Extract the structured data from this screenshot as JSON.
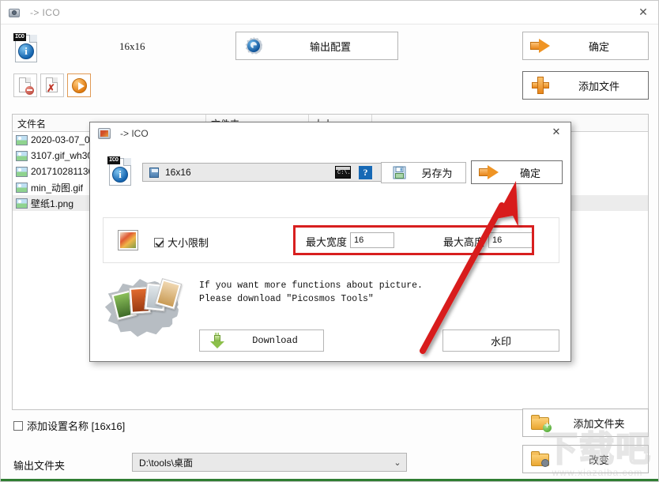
{
  "main_window": {
    "title": "-> ICO",
    "icon": "camera-icon",
    "close_label": "✕",
    "size_label": "16x16",
    "buttons": {
      "output_config": "输出配置",
      "confirm": "确定",
      "add_file": "添加文件",
      "add_folder": "添加文件夹",
      "change": "改变"
    },
    "toolbar": [
      {
        "name": "remove-file-button",
        "tooltip_icon": "document-minus-icon"
      },
      {
        "name": "clear-list-button",
        "tooltip_icon": "document-delete-icon"
      },
      {
        "name": "start-button",
        "tooltip_icon": "play-icon"
      }
    ],
    "file_list": {
      "columns": [
        "文件名",
        "文件夹",
        "大小",
        ""
      ],
      "rows": [
        {
          "name": "2020-03-07_0",
          "selected": false
        },
        {
          "name": "3107.gif_wh30",
          "selected": false
        },
        {
          "name": "201710281130",
          "selected": false
        },
        {
          "name": "min_动图.gif",
          "selected": false
        },
        {
          "name": "壁纸1.png",
          "selected": true
        }
      ]
    },
    "add_setting_name": {
      "label": "添加设置名称 [16x16]",
      "checked": false
    },
    "output_folder": {
      "label": "输出文件夹",
      "value": "D:\\tools\\桌面"
    }
  },
  "dialog": {
    "title": "-> ICO",
    "close_label": "✕",
    "preset": {
      "value": "16x16"
    },
    "icons": {
      "cmd": "cmd-icon",
      "cmd_text": "C:\\.",
      "help": "?"
    },
    "buttons": {
      "save_as": "另存为",
      "confirm": "确定",
      "download": "Download",
      "watermark": "水印"
    },
    "size_limit": {
      "label": "大小限制",
      "checked": true,
      "max_width_label": "最大宽度",
      "max_width_value": "16",
      "max_height_label": "最大高度",
      "max_height_value": "16"
    },
    "promo": {
      "line1": "If you want more functions about picture.",
      "line2": "Please download \"Picosmos Tools\""
    }
  },
  "annotation": {
    "highlight_color": "#d81f1f",
    "arrow_color": "#d81f1f"
  },
  "watermark": {
    "text": "下载吧",
    "url": "www.xiazaiba.com"
  }
}
